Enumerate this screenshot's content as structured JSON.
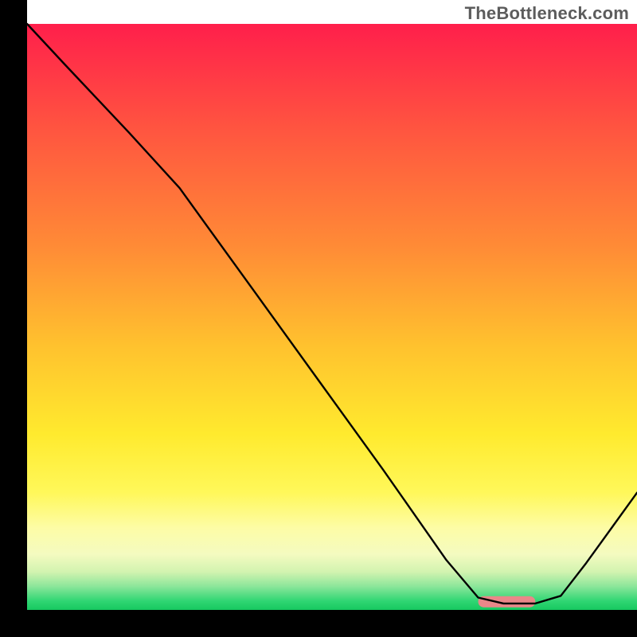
{
  "watermark": "TheBottleneck.com",
  "chart_data": {
    "type": "line",
    "title": "",
    "xlabel": "",
    "ylabel": "",
    "xlim": [
      0,
      100
    ],
    "ylim": [
      0,
      100
    ],
    "grid": false,
    "series": [
      {
        "name": "curve",
        "x": [
          4,
          10,
          20,
          28,
          40,
          50,
          60,
          70,
          75,
          79,
          84,
          88,
          92,
          96,
          100
        ],
        "y": [
          100,
          93,
          81.5,
          72,
          54,
          39,
          24,
          8.5,
          2.1,
          1.1,
          1.1,
          2.4,
          8,
          14,
          20
        ]
      }
    ],
    "optimal_marker": {
      "x_start": 75,
      "x_end": 84,
      "y": 1.4,
      "color": "#e98789"
    },
    "axes": {
      "left_x": 4,
      "right_x": 100,
      "bottom_y": 0,
      "top_y": 100,
      "thickness": 8
    },
    "gradient_stops": [
      {
        "offset": 0.0,
        "color": "#ff1f4b"
      },
      {
        "offset": 0.18,
        "color": "#ff5540"
      },
      {
        "offset": 0.38,
        "color": "#ff8b36"
      },
      {
        "offset": 0.55,
        "color": "#ffc22e"
      },
      {
        "offset": 0.7,
        "color": "#ffea2e"
      },
      {
        "offset": 0.8,
        "color": "#fff85a"
      },
      {
        "offset": 0.86,
        "color": "#fdfca6"
      },
      {
        "offset": 0.905,
        "color": "#f4fbc0"
      },
      {
        "offset": 0.935,
        "color": "#d2f3b0"
      },
      {
        "offset": 0.96,
        "color": "#8be69a"
      },
      {
        "offset": 0.985,
        "color": "#2fd673"
      },
      {
        "offset": 1.0,
        "color": "#17c85f"
      }
    ]
  }
}
